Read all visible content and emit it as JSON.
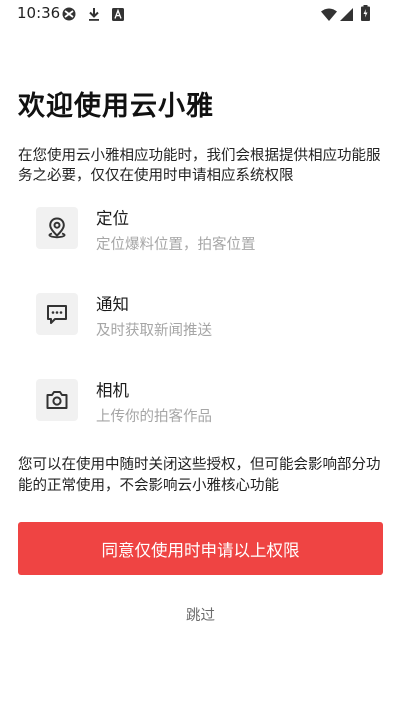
{
  "status_bar": {
    "time": "10:36",
    "left_icons": [
      "vpn-icon",
      "download-icon",
      "text-notification-icon"
    ],
    "right_icons": [
      "wifi-icon",
      "signal-icon",
      "battery-icon"
    ]
  },
  "title": "欢迎使用云小雅",
  "intro": "在您使用云小雅相应功能时，我们会根据提供相应功能服务之必要，仅仅在使用时申请相应系统权限",
  "permissions": [
    {
      "icon": "location-pin-icon",
      "name": "定位",
      "desc": "定位爆料位置，拍客位置"
    },
    {
      "icon": "message-icon",
      "name": "通知",
      "desc": "及时获取新闻推送"
    },
    {
      "icon": "camera-icon",
      "name": "相机",
      "desc": "上传你的拍客作品"
    }
  ],
  "note": "您可以在使用中随时关闭这些授权，但可能会影响部分功能的正常使用，不会影响云小雅核心功能",
  "agree_button": "同意仅使用时申请以上权限",
  "skip": "跳过",
  "colors": {
    "accent": "#ef4443",
    "icon_bg": "#f1f1f1",
    "muted_text": "#a6a6a6"
  }
}
